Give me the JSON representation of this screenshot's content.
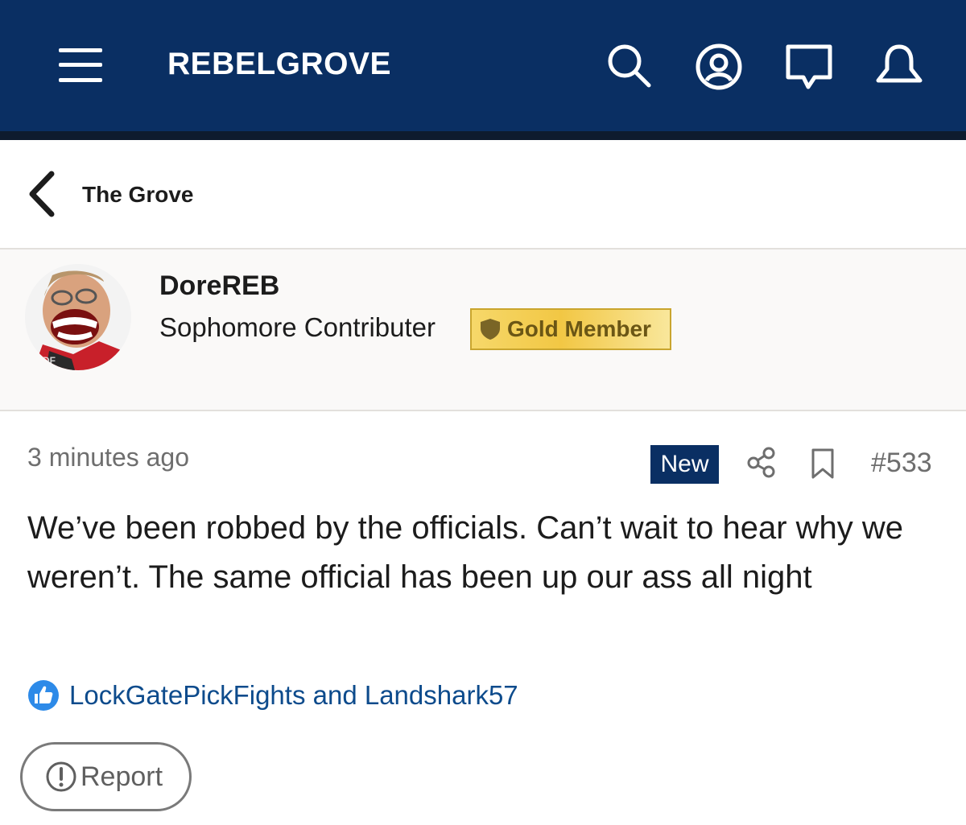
{
  "header": {
    "brand": "REBELGROVE",
    "icons": [
      "menu-icon",
      "search-icon",
      "account-icon",
      "messages-icon",
      "notifications-icon"
    ],
    "bg_color": "#0a2f63"
  },
  "breadcrumb": {
    "back_label": "The Grove"
  },
  "author": {
    "username": "DoreREB",
    "rank": "Sophomore Contributer",
    "badge": "Gold Member",
    "avatar_text": "DF"
  },
  "post": {
    "timestamp": "3 minutes ago",
    "new_label": "New",
    "post_number": "#533",
    "body": "We’ve been robbed by the officials. Can’t wait to hear why we weren’t. The same official has been up our ass all night",
    "likes": "LockGatePickFights and Landshark57"
  },
  "actions": {
    "report_label": "Report"
  },
  "colors": {
    "accent": "#0a2f63",
    "link": "#0d4b8c",
    "gold": "#f2c744"
  }
}
